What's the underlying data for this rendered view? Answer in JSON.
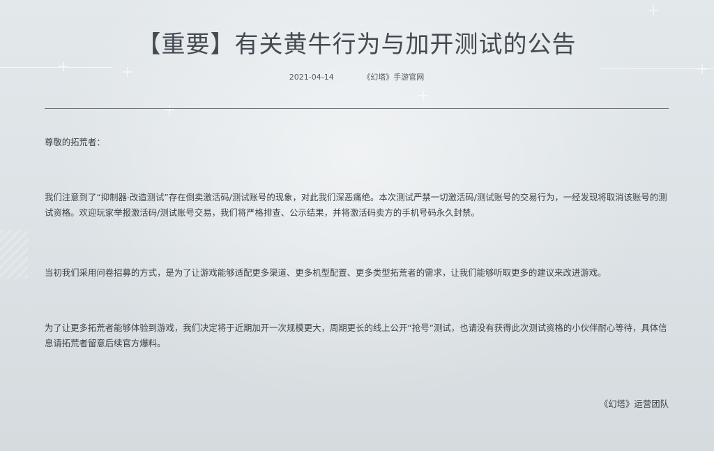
{
  "article": {
    "title": "【重要】有关黄牛行为与加开测试的公告",
    "date": "2021-04-14",
    "source": "《幻塔》手游官网",
    "greeting": "尊敬的拓荒者：",
    "paragraphs": [
      "我们注意到了“抑制器·改造测试”存在倒卖激活码/测试账号的现象，对此我们深恶痛绝。本次测试严禁一切激活码/测试账号的交易行为，一经发现将取消该账号的测试资格。欢迎玩家举报激活码/测试账号交易，我们将严格排查、公示结果，并将激活码卖方的手机号码永久封禁。",
      "当初我们采用问卷招募的方式，是为了让游戏能够适配更多渠道、更多机型配置、更多类型拓荒者的需求，让我们能够听取更多的建议来改进游戏。",
      "为了让更多拓荒者能够体验到游戏，我们决定将于近期加开一次规模更大，周期更长的线上公开“抢号”测试，也请没有获得此次测试资格的小伙伴耐心等待，具体信息请拓荒者留意后续官方爆料。"
    ],
    "signature": "《幻塔》运营团队"
  }
}
